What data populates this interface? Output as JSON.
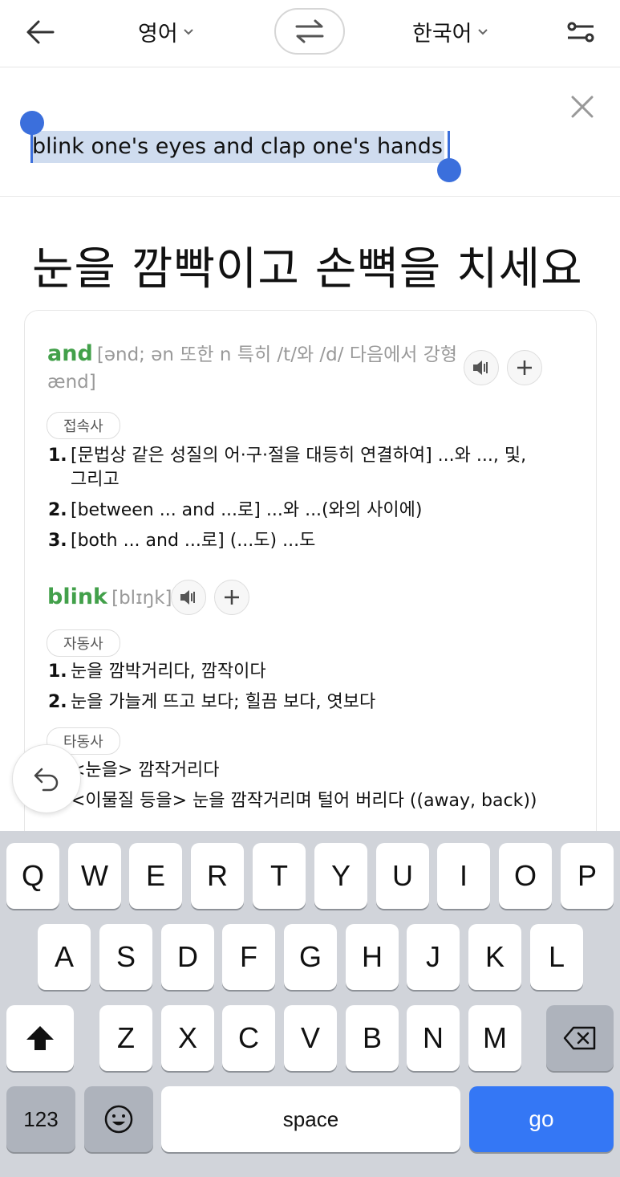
{
  "header": {
    "source_lang": "영어",
    "target_lang": "한국어"
  },
  "input": {
    "query": "blink one's eyes and clap one's hands"
  },
  "translation": "눈을 깜빡이고 손뼉을 치세요",
  "dictionary": {
    "and": {
      "word": "and",
      "pron_line1": "[ənd; ən 또한 n 특히 /t/와 /d/ 다음에서 강형",
      "pron_line2": "ænd]",
      "pos": "접속사",
      "defs": [
        {
          "num": "1.",
          "line1": "[문법상 같은 성질의 어·구·절을 대등히 연결하여] ...와 ..., 및,",
          "line2": "그리고"
        },
        {
          "num": "2.",
          "line1": "[between ... and ...로] ...와 ...(와의 사이에)"
        },
        {
          "num": "3.",
          "line1": "[both ... and ...로] (...도) ...도"
        }
      ]
    },
    "blink": {
      "word": "blink",
      "pron": "[blɪŋk]",
      "pos1": "자동사",
      "defs1": [
        {
          "num": "1.",
          "text": "눈을 깜박거리다, 깜작이다"
        },
        {
          "num": "2.",
          "text": "눈을 가늘게 뜨고 보다; 힐끔 보다, 엿보다"
        }
      ],
      "pos2": "타동사",
      "defs2": [
        {
          "text": "<눈을> 깜작거리다"
        },
        {
          "text": "<이물질 등을> 눈을 깜작거리며 털어 버리다 ((away, back))"
        }
      ]
    }
  },
  "keyboard": {
    "row1": [
      "Q",
      "W",
      "E",
      "R",
      "T",
      "Y",
      "U",
      "I",
      "O",
      "P"
    ],
    "row2": [
      "A",
      "S",
      "D",
      "F",
      "G",
      "H",
      "J",
      "K",
      "L"
    ],
    "row3": [
      "Z",
      "X",
      "C",
      "V",
      "B",
      "N",
      "M"
    ],
    "numbers_key": "123",
    "space_key": "space",
    "go_key": "go"
  },
  "colors": {
    "accent_blue": "#3477f5",
    "headword_green": "#42a04a",
    "selection": "#cfdcef"
  },
  "icons": [
    "back-arrow-icon",
    "chevron-down-icon",
    "swap-icon",
    "settings-sliders-icon",
    "close-icon",
    "speaker-icon",
    "plus-icon",
    "undo-icon",
    "shift-icon",
    "backspace-icon",
    "emoji-icon"
  ]
}
